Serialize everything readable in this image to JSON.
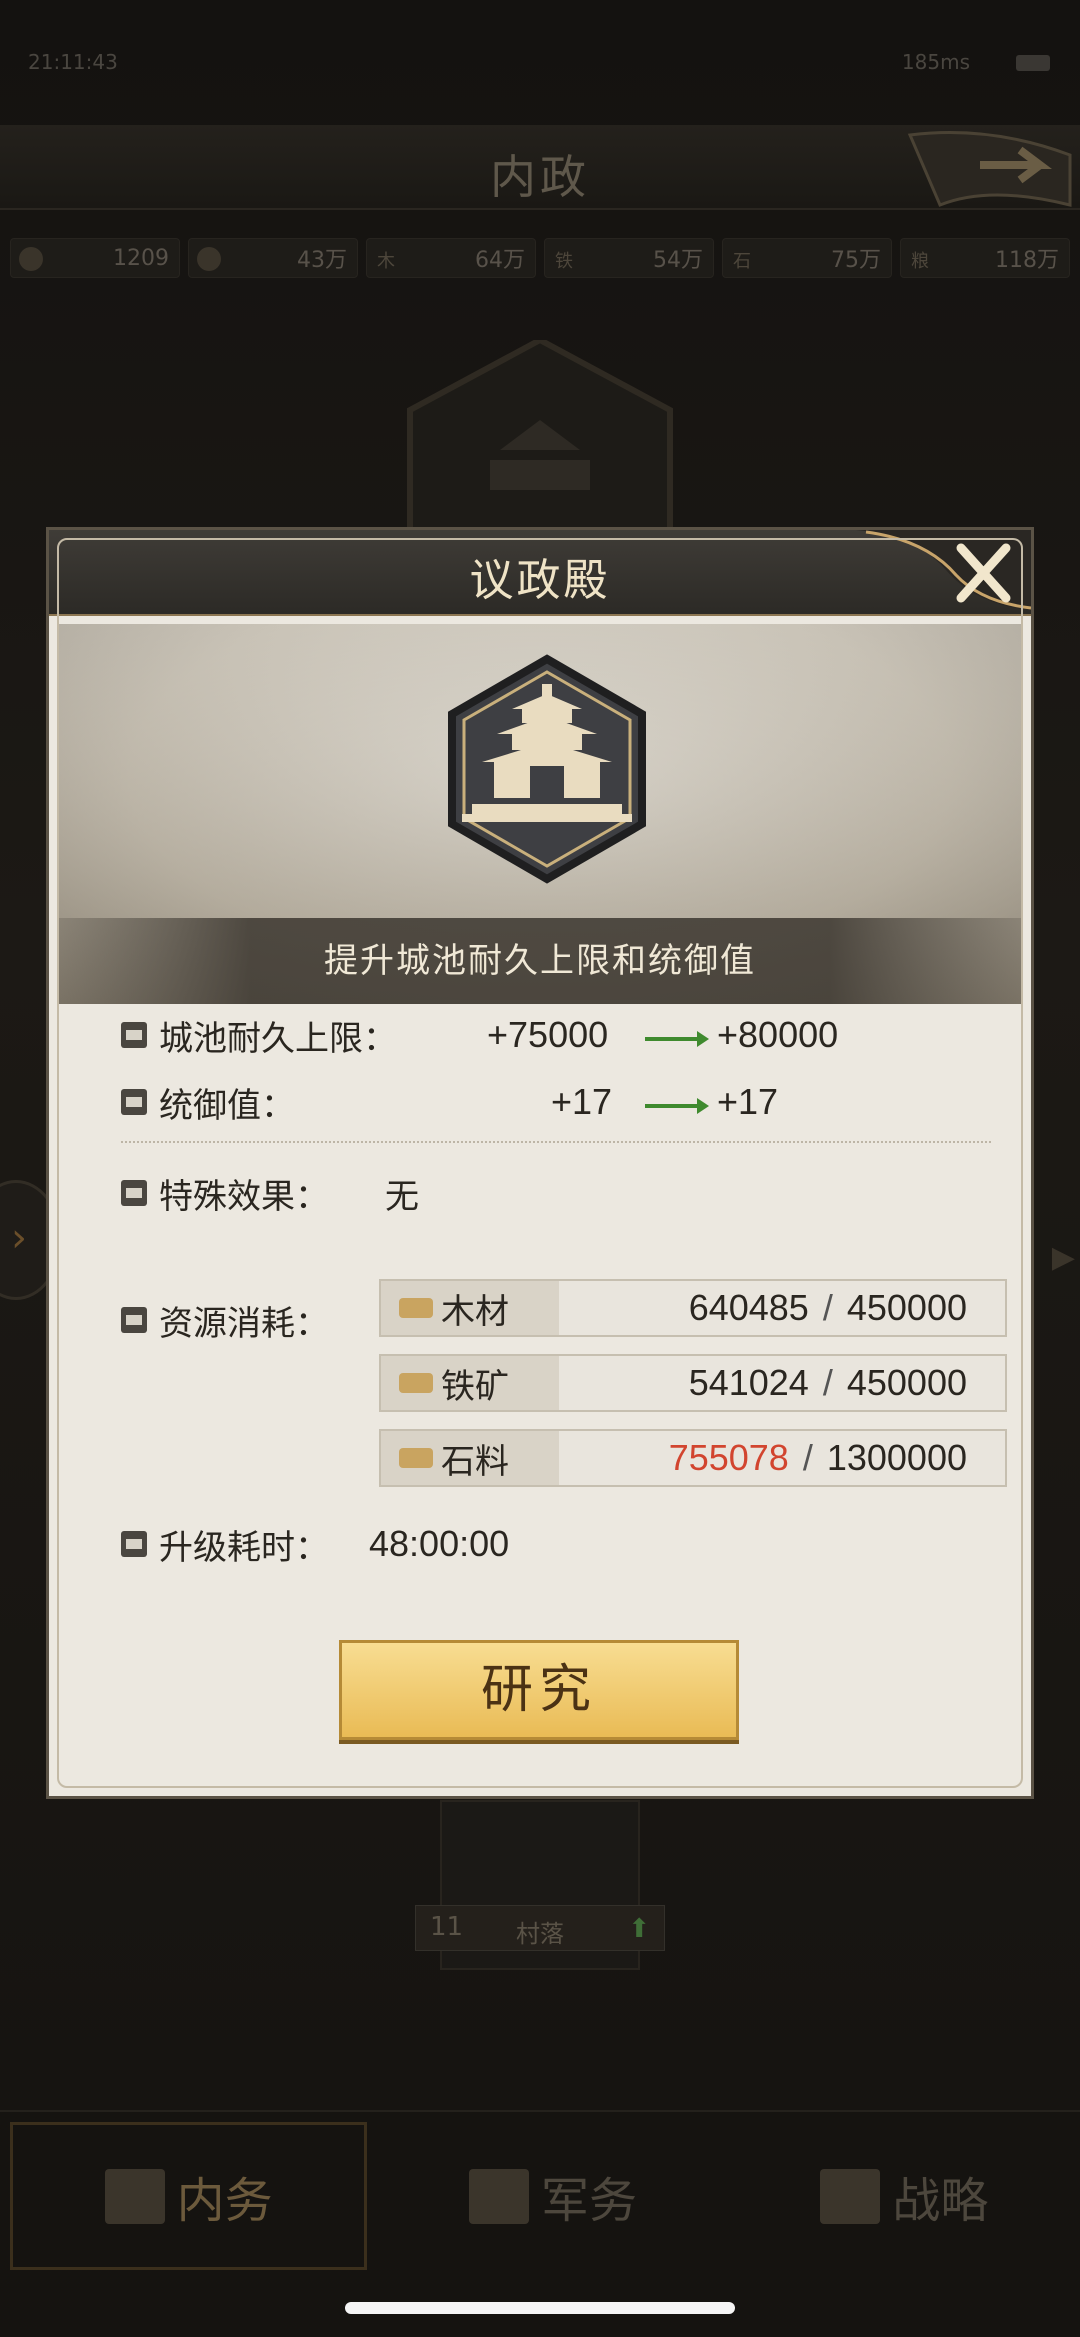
{
  "status": {
    "time": "21:11:43",
    "network": "185ms"
  },
  "screen": {
    "title": "内政"
  },
  "resources": [
    {
      "label": "",
      "value": "1209"
    },
    {
      "label": "",
      "value": "43万"
    },
    {
      "label": "木",
      "value": "64万"
    },
    {
      "label": "铁",
      "value": "54万"
    },
    {
      "label": "石",
      "value": "75万"
    },
    {
      "label": "粮",
      "value": "118万"
    }
  ],
  "village": {
    "level": "11",
    "name": "村落"
  },
  "nav": {
    "tab1": "内务",
    "tab2": "军务",
    "tab3": "战略"
  },
  "dialog": {
    "title": "议政殿",
    "banner_caption": "提升城池耐久上限和统御值",
    "stats": [
      {
        "label": "城池耐久上限：",
        "from": "+75000",
        "to": "+80000"
      },
      {
        "label": "统御值：",
        "from": "+17",
        "to": "+17"
      }
    ],
    "special": {
      "label": "特殊效果：",
      "value": "无"
    },
    "cost_label": "资源消耗：",
    "costs": [
      {
        "name": "木材",
        "have": "640485",
        "need": "450000",
        "sufficient": true
      },
      {
        "name": "铁矿",
        "have": "541024",
        "need": "450000",
        "sufficient": true
      },
      {
        "name": "石料",
        "have": "755078",
        "need": "1300000",
        "sufficient": false
      }
    ],
    "time": {
      "label": "升级耗时：",
      "value": "48:00:00"
    },
    "button": "研究"
  },
  "colors": {
    "insufficient": "#d2452f",
    "arrow": "#3f8a2e",
    "button": "#f0c86a"
  }
}
